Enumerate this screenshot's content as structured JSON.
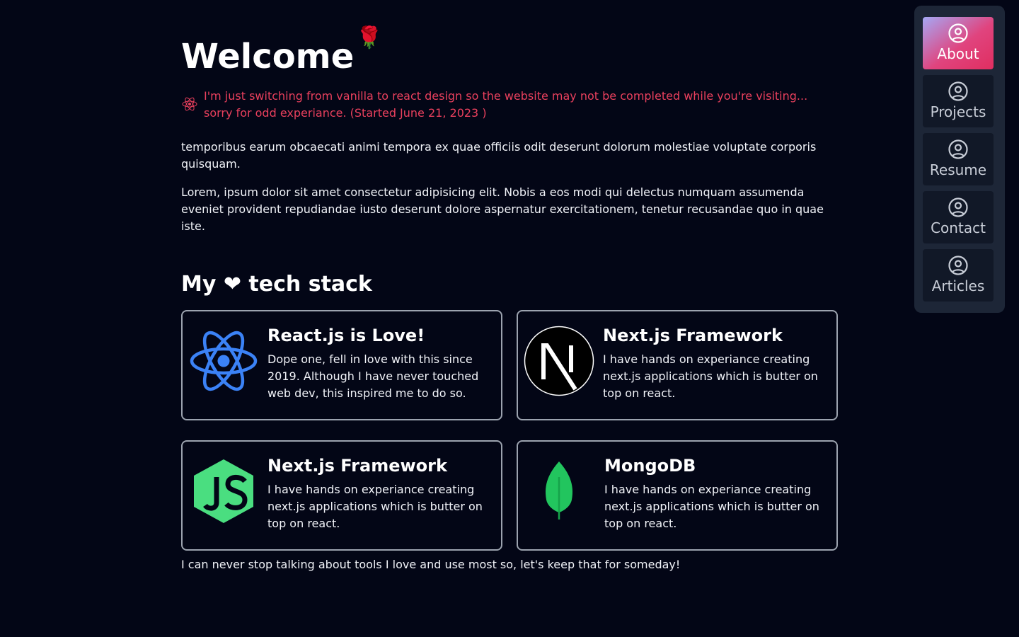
{
  "header": {
    "title": "Welcome",
    "decoration": "🌹"
  },
  "notice": {
    "icon": "react-icon",
    "text": "I'm just switching from vanilla to react design so the website may not be completed while you're visiting... sorry for odd experiance. (Started June 21, 2023 )"
  },
  "intro": {
    "paragraph1": "temporibus earum obcaecati animi tempora ex quae officiis odit deserunt dolorum molestiae voluptate corporis quisquam.",
    "paragraph2": "Lorem, ipsum dolor sit amet consectetur adipisicing elit. Nobis a eos modi qui delectus numquam assumenda eveniet provident repudiandae iusto deserunt dolore aspernatur exercitationem, tenetur recusandae quo in quae iste."
  },
  "tech_stack": {
    "title": "My ❤ tech stack",
    "cards": [
      {
        "icon": "react-icon",
        "title": "React.js is Love!",
        "text": "Dope one, fell in love with this since 2019. Although I have never touched web dev, this inspired me to do so."
      },
      {
        "icon": "nextjs-icon",
        "title": "Next.js Framework",
        "text": "I have hands on experiance creating next.js applications which is butter on top on react."
      },
      {
        "icon": "nodejs-icon",
        "title": "Next.js Framework",
        "text": "I have hands on experiance creating next.js applications which is butter on top on react."
      },
      {
        "icon": "mongodb-leaf-icon",
        "title": "MongoDB",
        "text": "I have hands on experiance creating next.js applications which is butter on top on react."
      }
    ],
    "footer": "I can never stop talking about tools I love and use most so, let's keep that for someday!"
  },
  "nav": {
    "items": [
      {
        "label": "About",
        "icon": "user-circle-icon",
        "active": true
      },
      {
        "label": "Projects",
        "icon": "user-circle-icon",
        "active": false
      },
      {
        "label": "Resume",
        "icon": "user-circle-icon",
        "active": false
      },
      {
        "label": "Contact",
        "icon": "user-circle-icon",
        "active": false
      },
      {
        "label": "Articles",
        "icon": "user-circle-icon",
        "active": false
      }
    ]
  },
  "colors": {
    "background": "#030616",
    "notice": "#e9405d",
    "react": "#3b82f6",
    "node": "#4ade80",
    "mongodb": "#22c55e",
    "card_border": "#9ca3af",
    "nav_panel": "#1d2637",
    "nav_item": "#111827"
  }
}
